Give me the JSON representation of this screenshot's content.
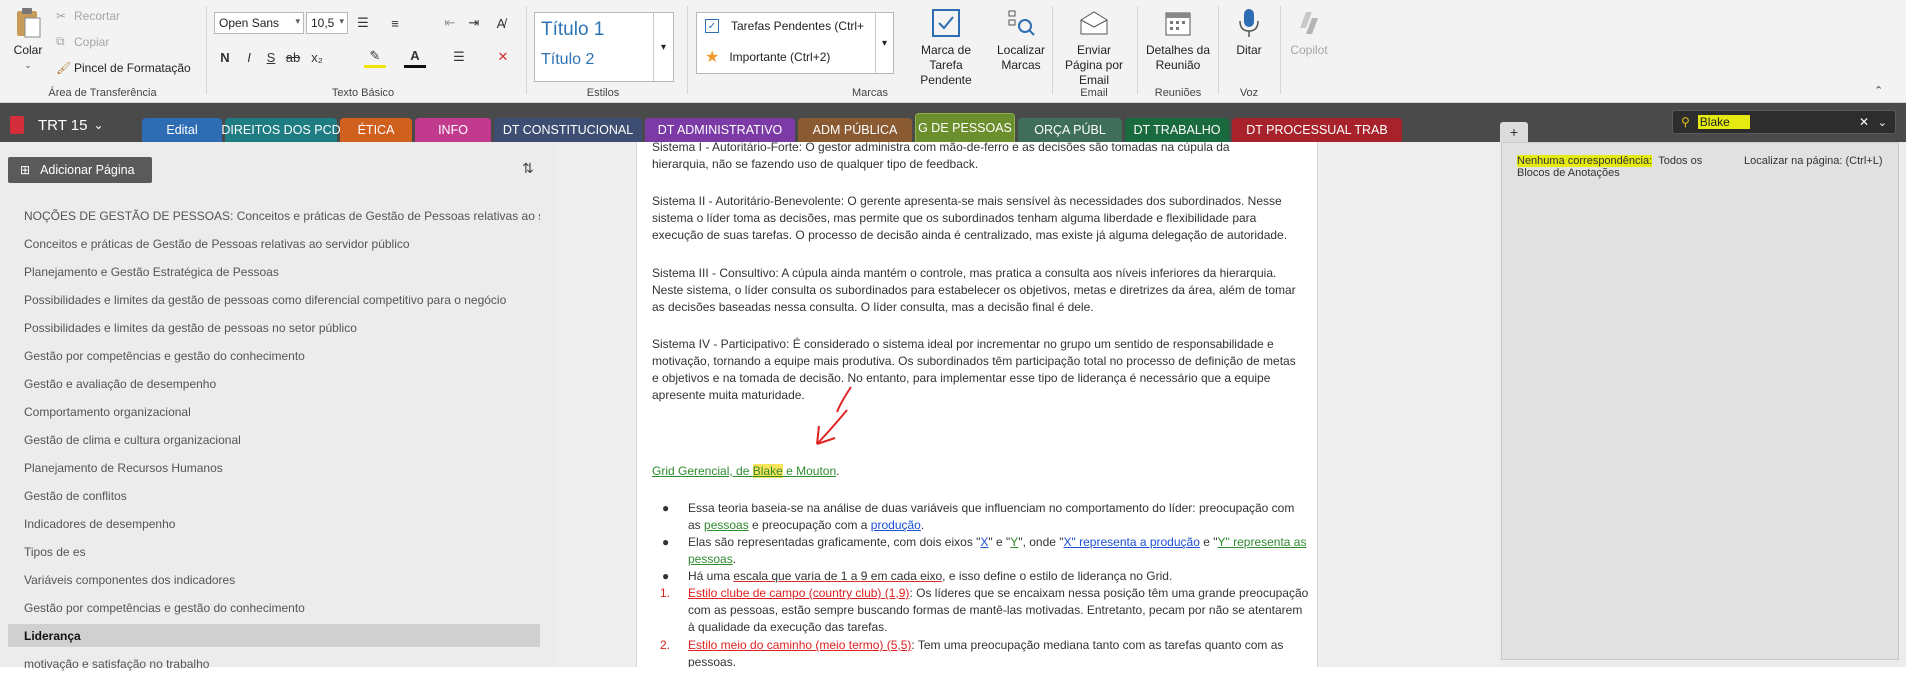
{
  "ribbon": {
    "clipboard": {
      "paste_label": "Colar",
      "cut_label": "Recortar",
      "copy_label": "Copiar",
      "format_painter_label": "Pincel de Formatação",
      "group_label": "Área de Transferência"
    },
    "basic_text": {
      "font_name": "Open Sans",
      "font_size": "10,5",
      "group_label": "Texto Básico"
    },
    "styles": {
      "title1": "Título 1",
      "title2": "Título 2",
      "group_label": "Estilos"
    },
    "tags": {
      "tag1": "Tarefas Pendentes (Ctrl+",
      "tag2": "Importante (Ctrl+2)",
      "todo_tag_label": "Marca de Tarefa Pendente",
      "find_tags_label": "Localizar Marcas",
      "group_label": "Marcas"
    },
    "email": {
      "send_label": "Enviar Página por Email",
      "group_label": "Email"
    },
    "meetings": {
      "details_label": "Detalhes da Reunião",
      "group_label": "Reuniões"
    },
    "voice": {
      "dictate_label": "Ditar",
      "group_label": "Voz"
    },
    "copilot_label": "Copilot"
  },
  "notebook": {
    "title": "TRT 15",
    "sections": [
      {
        "label": "Edital",
        "color": "#2e6db4"
      },
      {
        "label": "DIREITOS DOS PCD",
        "color": "#1e7d82"
      },
      {
        "label": "ÉTICA",
        "color": "#d0601e"
      },
      {
        "label": "INFO",
        "color": "#c23a8e"
      },
      {
        "label": "DT CONSTITUCIONAL",
        "color": "#3d4e72"
      },
      {
        "label": "DT ADMINISTRATIVO",
        "color": "#7b3aa6"
      },
      {
        "label": "ADM PÚBLICA",
        "color": "#8a5a33"
      },
      {
        "label": "G DE PESSOAS",
        "color": "#6c8f2d",
        "active": true
      },
      {
        "label": "ORÇA PÚBL",
        "color": "#3f6f5a"
      },
      {
        "label": "DT TRABALHO",
        "color": "#196a3c"
      },
      {
        "label": "DT PROCESSUAL TRAB",
        "color": "#a8222b"
      }
    ],
    "add_section_label": "+"
  },
  "search": {
    "query": "Blake",
    "no_match": "Nenhuma correspondência:",
    "scope": "Todos os Blocos de Anotações",
    "find_in_page": "Localizar na página: (Ctrl+L)"
  },
  "pages": {
    "add_label": "Adicionar Página",
    "items": [
      {
        "label": "NOÇÕES DE GESTÃO DE PESSOAS: Conceitos e práticas de Gestão de Pessoas relativas ao servidor público"
      },
      {
        "label": "Conceitos e práticas de Gestão de Pessoas relativas ao servidor público"
      },
      {
        "label": "Planejamento e Gestão Estratégica de Pessoas"
      },
      {
        "label": "Possibilidades e limites da gestão de pessoas como diferencial competitivo para o negócio"
      },
      {
        "label": "Possibilidades e limites da gestão de pessoas no setor público"
      },
      {
        "label": "Gestão por competências e gestão do conhecimento"
      },
      {
        "label": "Gestão e avaliação de desempenho"
      },
      {
        "label": "Comportamento organizacional"
      },
      {
        "label": "Gestão de clima e cultura organizacional"
      },
      {
        "label": "Planejamento de Recursos Humanos"
      },
      {
        "label": "Gestão de conflitos"
      },
      {
        "label": "Indicadores de desempenho"
      },
      {
        "label": "Tipos de es"
      },
      {
        "label": "Variáveis componentes dos indicadores"
      },
      {
        "label": "Gestão por competências e gestão do conhecimento"
      },
      {
        "label": "Liderança",
        "active": true
      },
      {
        "label": "motivação e satisfação no trabalho"
      }
    ]
  },
  "content": {
    "sys1_a": "Sistema I - Autoritário-Forte: O gestor administra com mão-de-ferro e as decisões são tomadas na cúpula da",
    "sys1_b": "hierarquia, não se fazendo uso de qualquer tipo de feedback.",
    "sys2_a": "Sistema II - Autoritário-Benevolente: O gerente apresenta-se mais sensível às necessidades dos subordinados. Nesse",
    "sys2_b": "sistema o líder toma as decisões, mas permite que os subordinados tenham alguma liberdade e flexibilidade para",
    "sys2_c": "execução de suas tarefas. O processo de decisão ainda é centralizado, mas existe já alguma delegação de autoridade.",
    "sys3_a": "Sistema III - Consultivo: A cúpula ainda mantém o controle, mas pratica a consulta aos níveis inferiores da hierarquia.",
    "sys3_b": "Neste sistema, o líder consulta os subordinados para estabelecer os objetivos, metas e diretrizes da área, além de tomar",
    "sys3_c": "as decisões baseadas nessa consulta. O líder consulta, mas a decisão final é dele.",
    "sys4_a": "Sistema IV - Participativo: É considerado o sistema ideal por incrementar no grupo um sentido de responsabilidade e",
    "sys4_b": "motivação, tornando a equipe mais produtiva. Os subordinados têm participação total no processo de definição de metas",
    "sys4_c": "e objetivos e na tomada de decisão. No entanto, para implementar esse tipo de liderança é necessário que a equipe",
    "sys4_d": "apresente muita maturidade.",
    "grid_pre": "Grid Gerencial, de ",
    "grid_blake": "Blake",
    "grid_mid": " e ",
    "grid_mouton": "Mouton",
    "grid_end": ".",
    "b1_pre": "Essa teoria baseia-se na análise de duas variáveis que influenciam no comportamento do líder: preocupação com",
    "b1_as": "as ",
    "b1_pessoas": "pessoas",
    "b1_mid": " e preocupação com a ",
    "b1_producao": "produção",
    "b1_end": ".",
    "b2_pre": "Elas são representadas graficamente, com dois eixos \"",
    "b2_x": "X",
    "b2_e": "\" e \"",
    "b2_y": "Y",
    "b2_onde": "\", onde \"",
    "b2_xrep": "X\" representa a produção",
    "b2_e2": " e \"",
    "b2_yrep": "Y\" representa as",
    "b2_pessoas": "pessoas",
    "b2_end": ".",
    "b3_pre": "Há uma ",
    "b3_escala": "escala que varia de 1 a 9 em cada eixo",
    "b3_end": ", e isso define o estilo de liderança no Grid.",
    "n1_num": "1.",
    "n1_style": "Estilo clube de campo (country club) (1,9)",
    "n1_a": ": Os líderes que se encaixam nessa posição têm uma grande preocupação",
    "n1_b": "com as pessoas, estão sempre buscando formas de mantê-las motivadas. Entretanto, pecam por não se atentarem",
    "n1_c": "à qualidade da execução das tarefas.",
    "n2_num": "2.",
    "n2_style": "Estilo meio do caminho (meio termo) (5,5)",
    "n2_a": ": Tem uma preocupação mediana tanto com as tarefas quanto com as",
    "n2_b": "pessoas."
  }
}
